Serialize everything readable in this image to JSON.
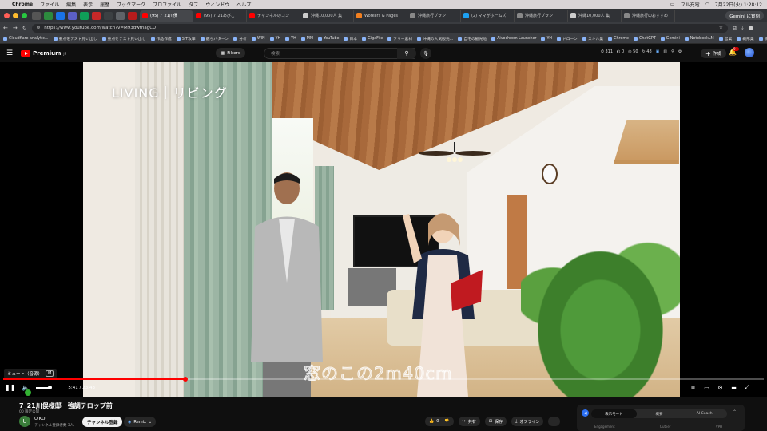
{
  "menubar": {
    "app": "Chrome",
    "items": [
      "ファイル",
      "編集",
      "表示",
      "履歴",
      "ブックマーク",
      "プロファイル",
      "タブ",
      "ウィンドウ",
      "ヘルプ"
    ],
    "datetime": "7月22日(火) 1:28:12",
    "battery": "フル充電"
  },
  "tabs": [
    {
      "label": "(95) 7_21川俣",
      "color": "#ff0000",
      "active": true
    },
    {
      "label": "(95) 7_21あびこ",
      "color": "#ff0000"
    },
    {
      "label": "チャンネルのコン",
      "color": "#ff0000"
    },
    {
      "label": "沖縄10,000人 集",
      "color": "#cccccc"
    },
    {
      "label": "Workers & Pages",
      "color": "#f38020"
    },
    {
      "label": "沖縄旅行プラン",
      "color": "#888888"
    },
    {
      "label": "(2) ママがホームズ",
      "color": "#1da1f2"
    },
    {
      "label": "沖縄旅行プラン",
      "color": "#888888"
    },
    {
      "label": "沖縄10,000人 集",
      "color": "#cccccc"
    },
    {
      "label": "沖縄旅行のおすすめ",
      "color": "#888888"
    }
  ],
  "gemini_label": "Gemini に質問",
  "address": {
    "url": "https://www.youtube.com/watch?v=M93dwtnagCU"
  },
  "bookmarks": [
    "Cloudflare analytic...",
    "重点をテスト見い出し",
    "重点をテスト見い出し",
    "作品作成",
    "SIT攻撃",
    "鑑ちパターン",
    "分析",
    "WIN",
    "YH",
    "YH",
    "MM",
    "YouTube",
    "日本",
    "GigaFile",
    "フリー素材",
    "沖縄の人気観光...",
    "自宅の観光地",
    "Aivochrom Launcher",
    "YH",
    "ドローン",
    "スキル集",
    "Chrome",
    "ChatGPT",
    "Gemini",
    "NotebookLM",
    "営業",
    "概形集",
    "便利サイト"
  ],
  "youtube": {
    "logo": "Premium",
    "logo_sup": "JP",
    "filters_label": "Filters",
    "search_placeholder": "検索",
    "stats": [
      "311",
      "0",
      "50",
      "48"
    ],
    "create_label": "作成",
    "notif_count": "9+"
  },
  "player": {
    "overlay_title": "LIVING｜リビング",
    "subtitle": "窓のこの2m40cm",
    "mute_tooltip": "ミュート（音源）",
    "mute_key": "M",
    "time_current": "5:41",
    "time_total": "23:43",
    "progress": 0.24
  },
  "video": {
    "title": "7_21川俣様邸　強調テロップ前",
    "meta": "00 限定公開",
    "channel_initial": "U",
    "channel": "U KO",
    "subs": "チャンネル登録者数 3人",
    "subscribe": "チャンネル登録",
    "remix": "Remix",
    "likes": "0",
    "share": "共有",
    "save": "保存",
    "offline": "オフライン"
  },
  "side_panel": {
    "tabs": [
      "表示モード",
      "概要",
      "AI Coach"
    ],
    "footer": [
      "Engagement",
      "Outlier",
      "VPH"
    ]
  }
}
